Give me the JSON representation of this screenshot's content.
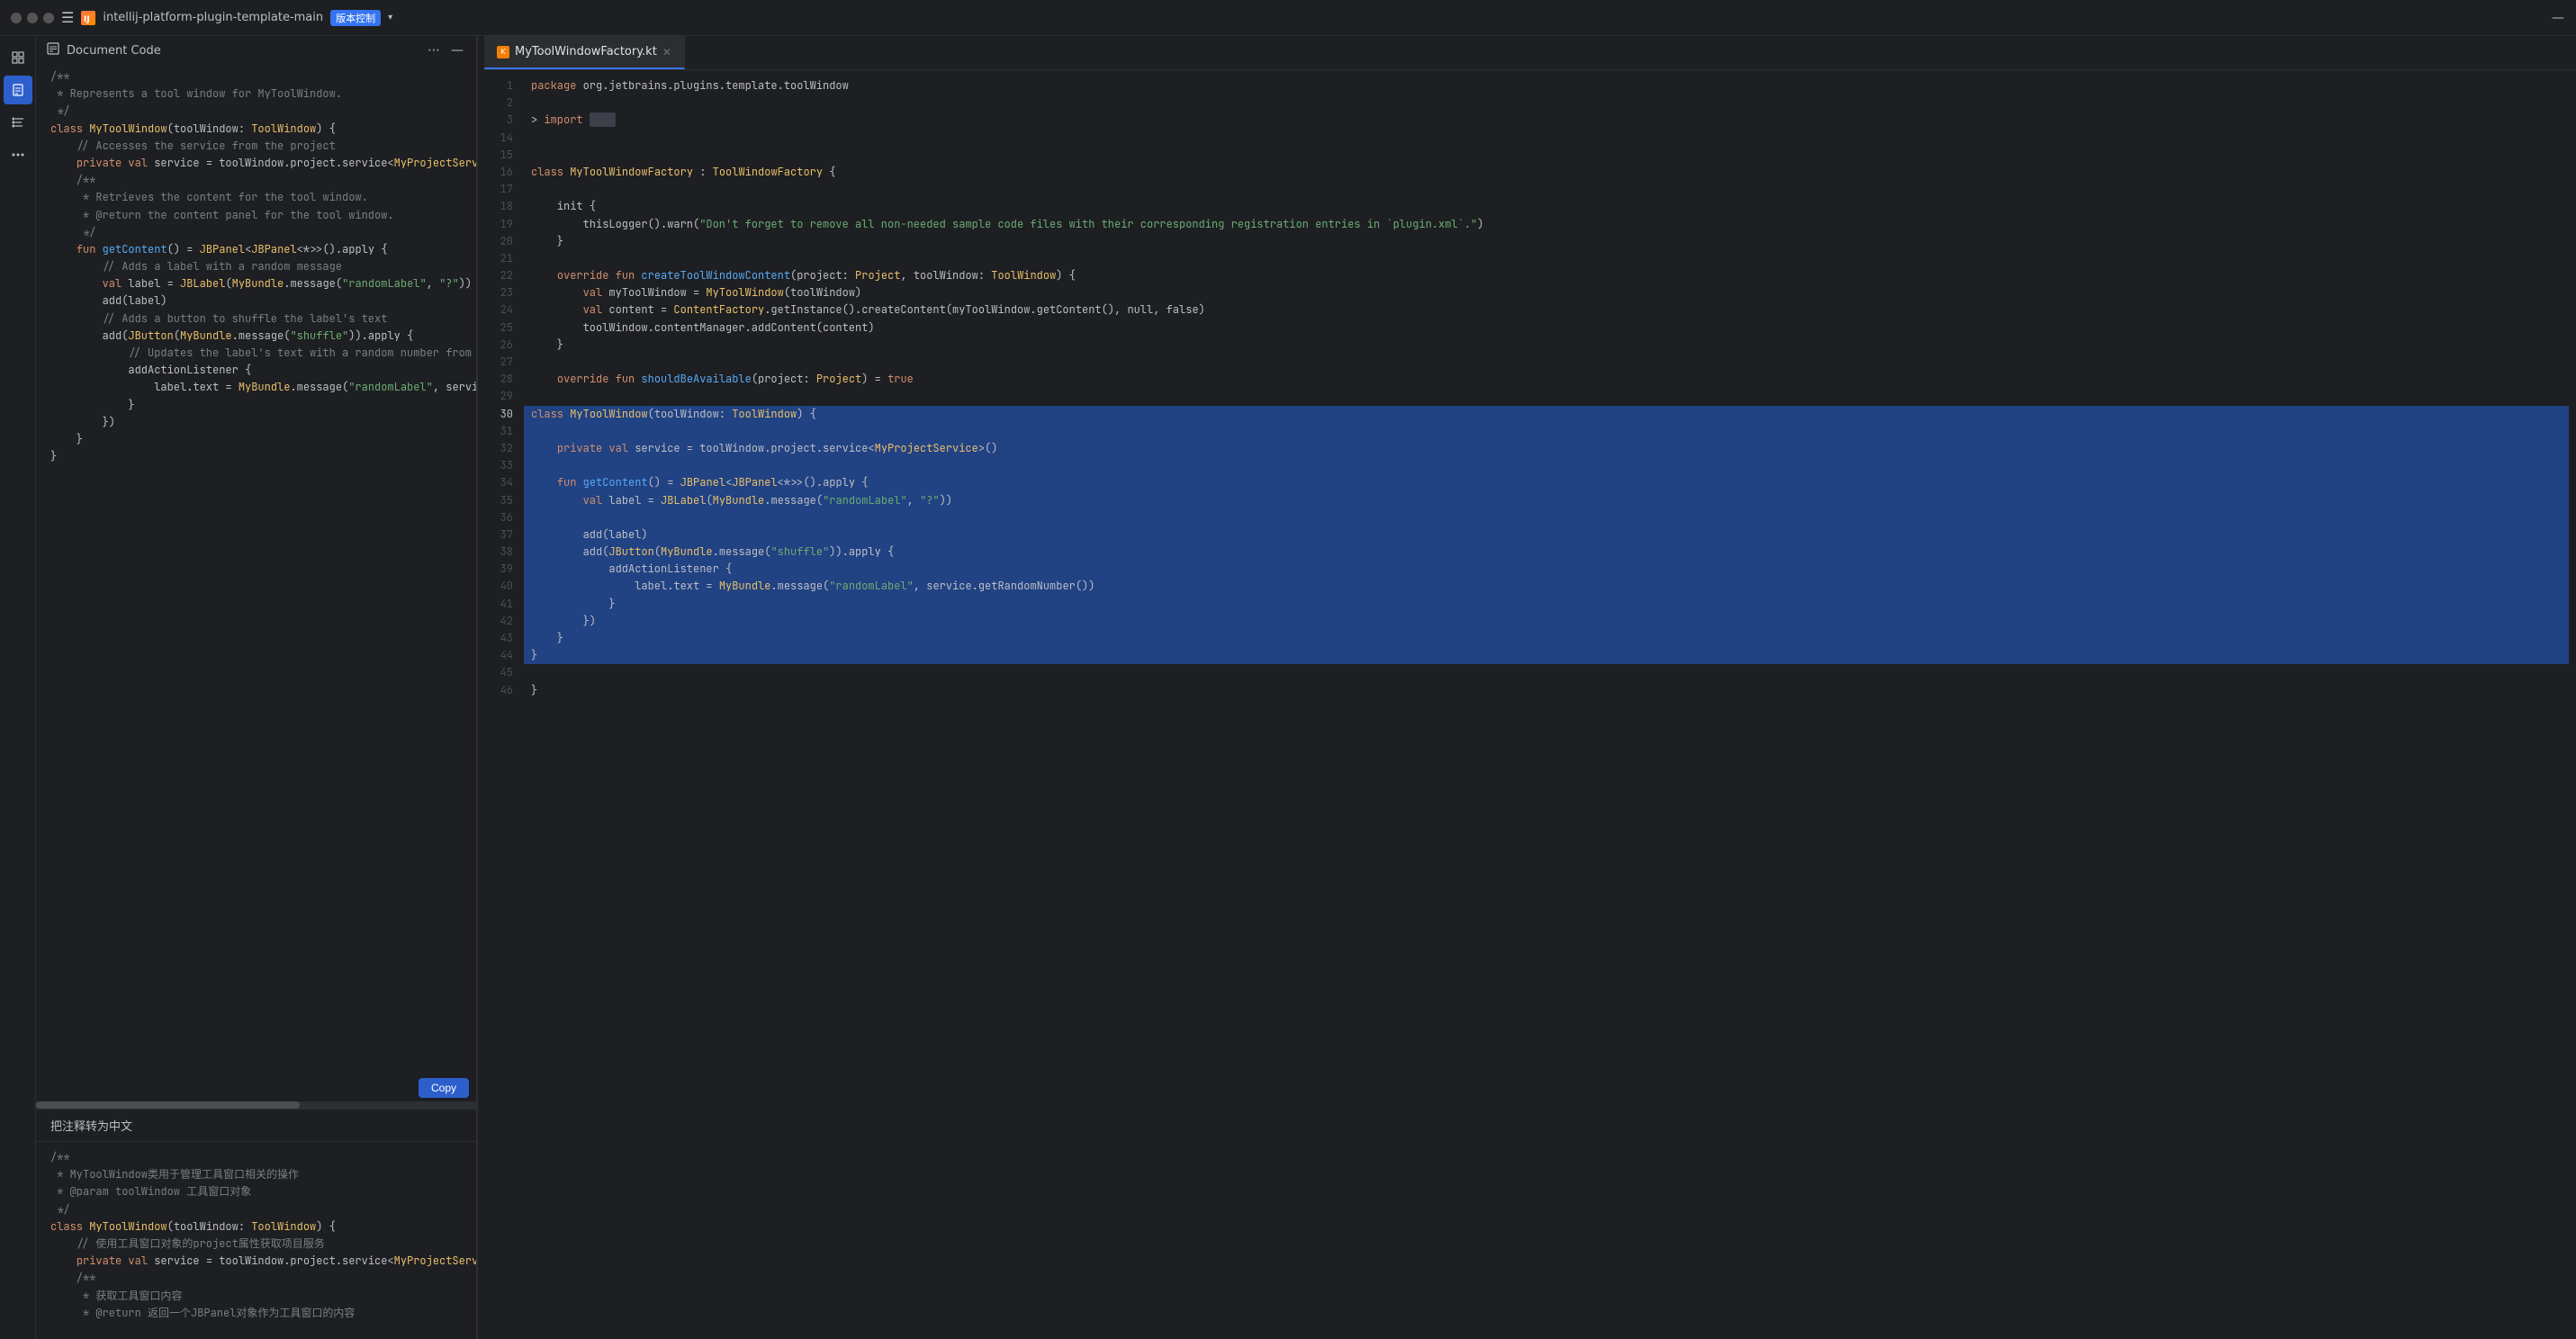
{
  "titleBar": {
    "projectName": "intellij-platform-plugin-template-main",
    "vcs": "版本控制",
    "controls": [
      "dots",
      "minimize"
    ],
    "hamburgerLabel": "☰"
  },
  "activityBar": {
    "items": [
      {
        "name": "project-icon",
        "icon": "⊞",
        "active": false
      },
      {
        "name": "document-code-icon",
        "icon": "📄",
        "active": true
      },
      {
        "name": "structure-icon",
        "icon": "⁞⁞",
        "active": false
      },
      {
        "name": "more-icon",
        "icon": "•••",
        "active": false
      }
    ]
  },
  "leftPanel": {
    "title": "Document Code",
    "topCode": [
      {
        "line": "/**",
        "type": "comment"
      },
      {
        " * Represents a tool window for MyToolWindow.": "",
        "type": "comment"
      },
      {
        " */": "",
        "type": "comment"
      },
      {
        "class MyToolWindow(toolWindow: ToolWindow) {": "",
        "type": "code"
      },
      {
        "": ""
      },
      {
        "    // Accesses the service from the project": "",
        "type": "comment"
      },
      {
        "    private val service = toolWindow.project.service<MyProjectService>()": "",
        "type": "code"
      },
      {
        "": ""
      },
      {
        "    /**": "",
        "type": "comment"
      },
      {
        "     * Retrieves the content for the tool window.": "",
        "type": "comment"
      },
      {
        "     * @return the content panel for the tool window.": "",
        "type": "comment"
      },
      {
        "     */": "",
        "type": "comment"
      },
      {
        "    fun getContent() = JBPanel<JBPanel<*>>().apply {": "",
        "type": "code"
      },
      {
        "        // Adds a label with a random message": "",
        "type": "comment"
      },
      {
        "        val label = JBLabel(MyBundle.message(\"randomLabel\", \"?\"))": "",
        "type": "code"
      },
      {
        "        add(label)": "",
        "type": "code"
      },
      {
        "": ""
      },
      {
        "        // Adds a button to shuffle the label's text": "",
        "type": "comment"
      },
      {
        "        add(JButton(MyBundle.message(\"shuffle\")).apply {": "",
        "type": "code"
      },
      {
        "            // Updates the label's text with a random number from the servic": "",
        "type": "comment"
      },
      {
        "            addActionListener {": "",
        "type": "code"
      },
      {
        "                label.text = MyBundle.message(\"randomLabel\", service.getRand": "",
        "type": "code"
      },
      {
        "            }": "",
        "type": "code"
      },
      {
        "        })": "",
        "type": "code"
      },
      {
        "    }": "",
        "type": "code"
      },
      {
        "": ""
      },
      {
        "}": "",
        "type": "code"
      }
    ],
    "copyButtonLabel": "Copy",
    "translateLabel": "把注释转为中文",
    "bottomCode": [
      {
        "line": "/**",
        "type": "comment"
      },
      {
        " * MyToolWindow类用于管理工具窗口相关的操作": "",
        "type": "comment"
      },
      {
        " * @param toolWindow 工具窗口对象": "",
        "type": "comment"
      },
      {
        " */": "",
        "type": "comment"
      },
      {
        "class MyToolWindow(toolWindow: ToolWindow) {": "",
        "type": "code"
      },
      {
        "": ""
      },
      {
        "    // 使用工具窗口对象的project属性获取项目服务": "",
        "type": "comment"
      },
      {
        "    private val service = toolWindow.project.service<MyProjectService>()": "",
        "type": "code"
      },
      {
        "": ""
      },
      {
        "    /**": "",
        "type": "comment"
      },
      {
        "     * 获取工具窗口内容": "",
        "type": "comment"
      },
      {
        "     * @return 返回一个JBPanel对象作为工具窗口的内容": "",
        "type": "comment"
      }
    ]
  },
  "editor": {
    "tabs": [
      {
        "name": "MyToolWindowFactory.kt",
        "icon": "K",
        "active": true,
        "closeable": true
      }
    ],
    "lines": [
      {
        "num": 1,
        "content": "package org.jetbrains.plugins.template.toolWindow",
        "selected": false
      },
      {
        "num": 2,
        "content": "",
        "selected": false
      },
      {
        "num": 3,
        "content": "> import ...",
        "selected": false,
        "folded": true
      },
      {
        "num": 14,
        "content": "",
        "selected": false
      },
      {
        "num": 15,
        "content": "",
        "selected": false
      },
      {
        "num": 16,
        "content": "class MyToolWindowFactory : ToolWindowFactory {",
        "selected": false
      },
      {
        "num": 17,
        "content": "",
        "selected": false
      },
      {
        "num": 18,
        "content": "    init {",
        "selected": false
      },
      {
        "num": 19,
        "content": "        thisLogger().warn(\"Don't forget to remove all non-needed sample code files with their corresponding registration entries in `plugin.xml`.\")",
        "selected": false
      },
      {
        "num": 20,
        "content": "    }",
        "selected": false
      },
      {
        "num": 21,
        "content": "",
        "selected": false
      },
      {
        "num": 22,
        "content": "    override fun createToolWindowContent(project: Project, toolWindow: ToolWindow) {",
        "selected": false
      },
      {
        "num": 23,
        "content": "        val myToolWindow = MyToolWindow(toolWindow)",
        "selected": false
      },
      {
        "num": 24,
        "content": "        val content = ContentFactory.getInstance().createContent(myToolWindow.getContent(), null, false)",
        "selected": false
      },
      {
        "num": 25,
        "content": "        toolWindow.contentManager.addContent(content)",
        "selected": false
      },
      {
        "num": 26,
        "content": "    }",
        "selected": false
      },
      {
        "num": 27,
        "content": "",
        "selected": false
      },
      {
        "num": 28,
        "content": "    override fun shouldBeAvailable(project: Project) = true",
        "selected": false
      },
      {
        "num": 29,
        "content": "",
        "selected": false
      },
      {
        "num": 30,
        "content": "class MyToolWindow(toolWindow: ToolWindow) {",
        "selected": true
      },
      {
        "num": 31,
        "content": "",
        "selected": true
      },
      {
        "num": 32,
        "content": "    private val service = toolWindow.project.service<MyProjectService>()",
        "selected": true
      },
      {
        "num": 33,
        "content": "",
        "selected": true
      },
      {
        "num": 34,
        "content": "    fun getContent() = JBPanel<JBPanel<*>>().apply {",
        "selected": true
      },
      {
        "num": 35,
        "content": "        val label = JBLabel(MyBundle.message(\"randomLabel\", \"?\"))",
        "selected": true
      },
      {
        "num": 36,
        "content": "",
        "selected": true
      },
      {
        "num": 37,
        "content": "        add(label)",
        "selected": true
      },
      {
        "num": 38,
        "content": "        add(JButton(MyBundle.message(\"shuffle\")).apply {",
        "selected": true
      },
      {
        "num": 39,
        "content": "            addActionListener {",
        "selected": true
      },
      {
        "num": 40,
        "content": "                label.text = MyBundle.message(\"randomLabel\", service.getRandomNumber())",
        "selected": true
      },
      {
        "num": 41,
        "content": "            }",
        "selected": true
      },
      {
        "num": 42,
        "content": "        })",
        "selected": true
      },
      {
        "num": 43,
        "content": "    }",
        "selected": true
      },
      {
        "num": 44,
        "content": "}",
        "selected": true
      },
      {
        "num": 45,
        "content": "",
        "selected": false
      },
      {
        "num": 46,
        "content": "}",
        "selected": false
      }
    ]
  },
  "colors": {
    "background": "#1e1f22",
    "panelBg": "#2b2d30",
    "accent": "#3574f0",
    "selected": "#214283",
    "comment": "#7a7e85",
    "keyword": "#cf8e6d",
    "string": "#6aab73",
    "classColor": "#e8bf6a",
    "funcColor": "#56a8f5",
    "text": "#bcbec4"
  }
}
